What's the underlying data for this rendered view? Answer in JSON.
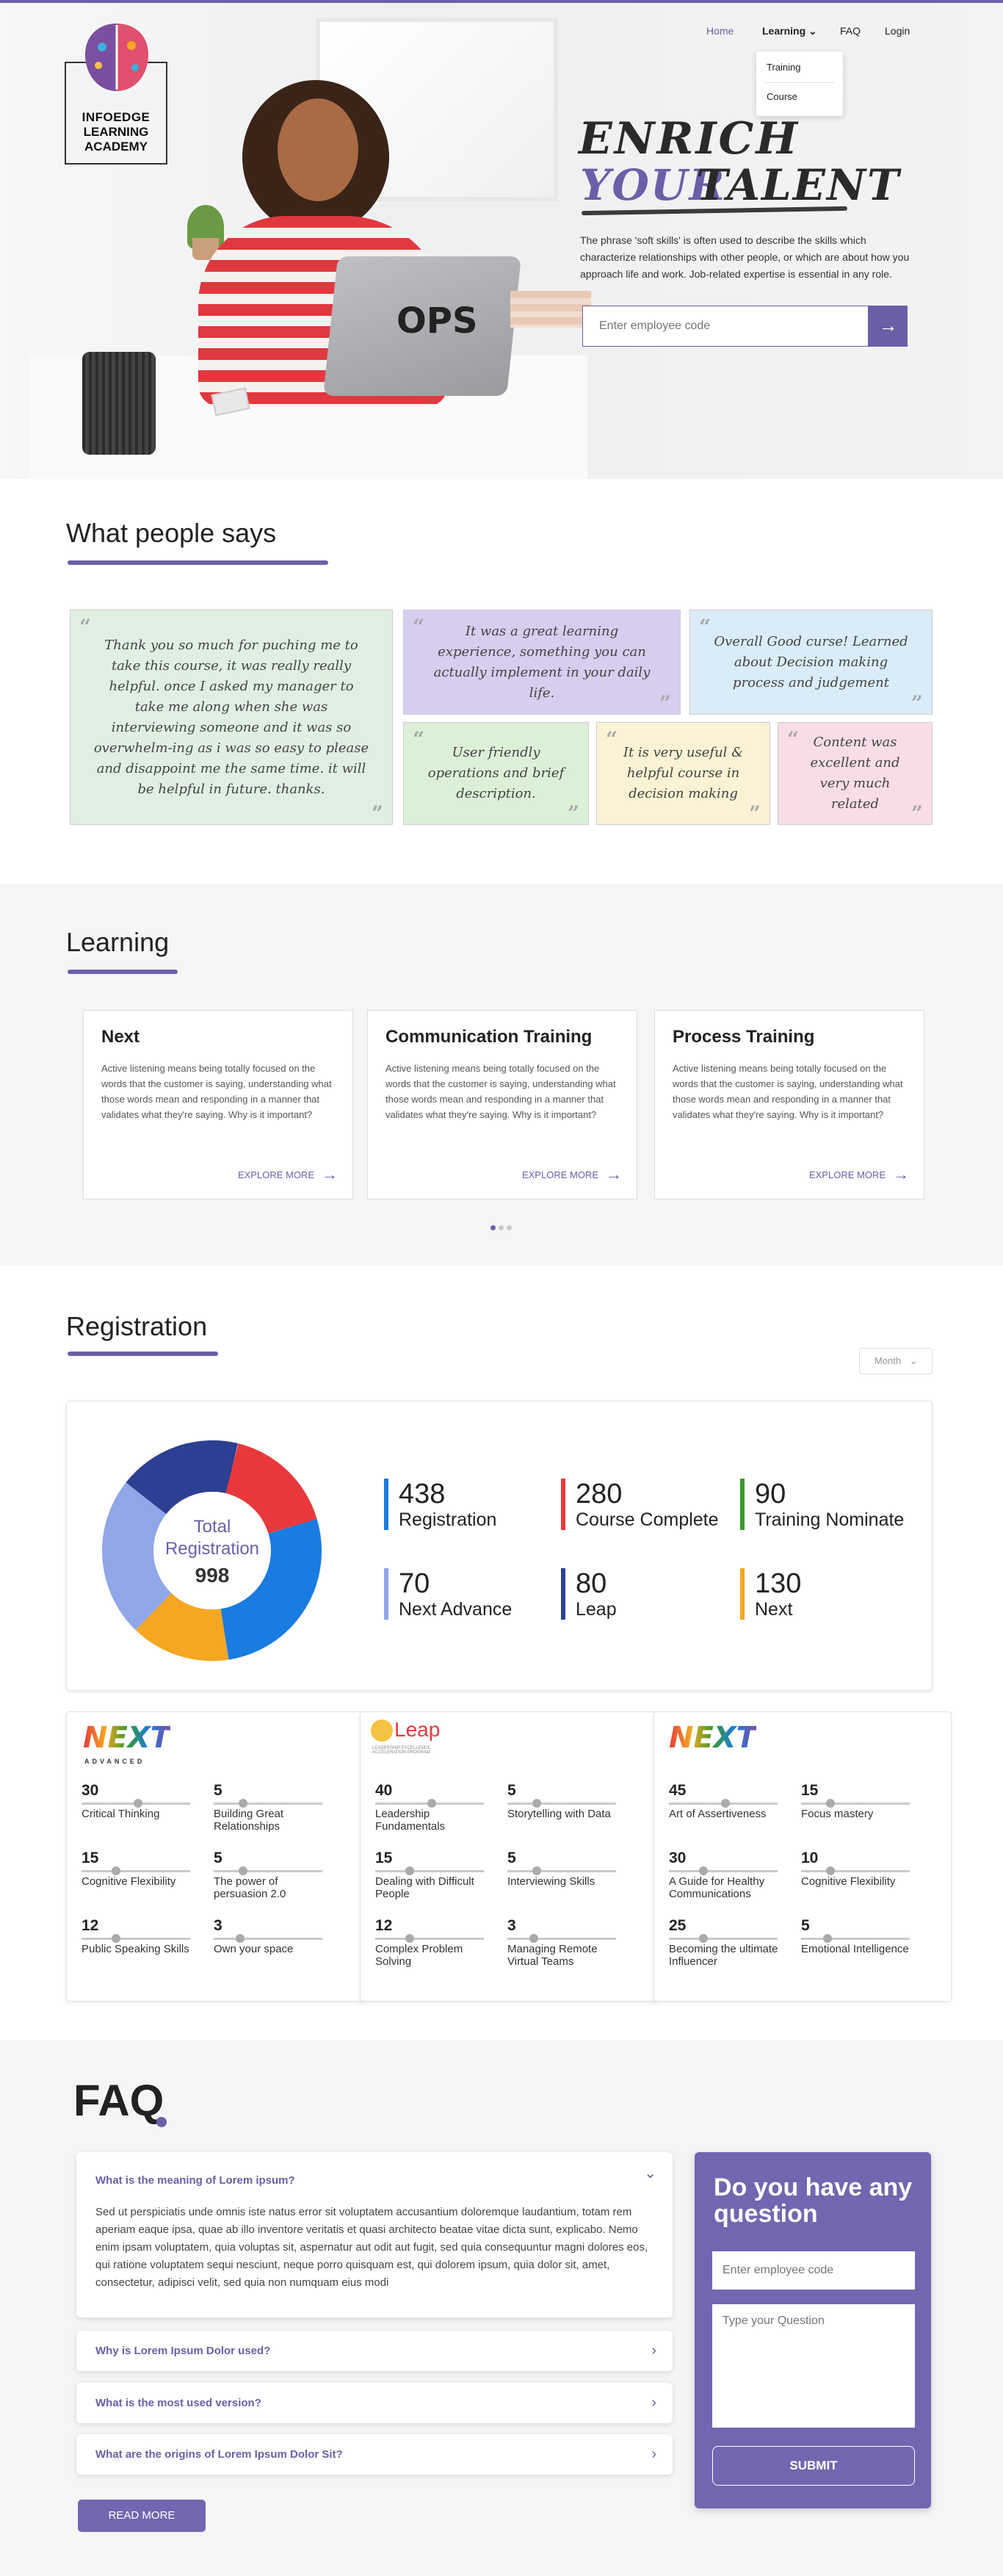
{
  "brand": {
    "line1": "INFOEDGE",
    "line2": "LEARNING",
    "line3": "ACADEMY",
    "laptop_logo": "OPS"
  },
  "nav": {
    "items": [
      {
        "label": "Home",
        "active": true
      },
      {
        "label": "Learning",
        "active": false,
        "has_dropdown": true
      },
      {
        "label": "FAQ",
        "active": false
      },
      {
        "label": "Login",
        "active": false
      }
    ],
    "dropdown": [
      "Training",
      "Course"
    ]
  },
  "hero": {
    "title_line1": "ENRICH",
    "title_line2a": "YOUR",
    "title_line2b": "TALENT",
    "description": "The phrase 'soft skills' is often used to describe the skills which characterize relationships with other people, or which are about how you approach life and work. Job-related expertise is essential in any role.",
    "input_placeholder": "Enter employee code",
    "submit_icon": "arrow-right-icon"
  },
  "testimonials": {
    "title": "What people says",
    "items": [
      "Thank you so much for puching me to take this course, it was really really helpful. once I asked my manager to take me along when she was interviewing someone and it was so overwhelm-ing as i was so easy to please and disappoint me the same time. it will be helpful in future. thanks.",
      "It was a great learning experience, something you can actually implement in your daily life.",
      "Overall Good curse! Learned about Decision making process and judgement",
      "User friendly operations and brief description.",
      "It is very useful & helpful course in decision making",
      "Content was excellent and very much related"
    ],
    "colors": [
      "#dff0e1",
      "#d7cdee",
      "#d9ecf7",
      "#dcefd7",
      "#fbf1d3",
      "#f8dde8"
    ]
  },
  "learning": {
    "title": "Learning",
    "cards": [
      {
        "title": "Next",
        "text": "Active listening means being totally focused on the words that the customer is saying, understanding what those words mean and responding in a manner that validates what they're saying. Why is it important?",
        "more": "EXPLORE MORE"
      },
      {
        "title": "Communication Training",
        "text": "Active listening means being totally focused on the words that the customer is saying, understanding what those words mean and responding in a manner that validates what they're saying. Why is it important?",
        "more": "EXPLORE MORE"
      },
      {
        "title": "Process Training",
        "text": "Active listening means being totally focused on the words that the customer is saying, understanding what those words mean and responding in a manner that validates what they're saying. Why is it important?",
        "more": "EXPLORE MORE"
      }
    ]
  },
  "registration": {
    "title": "Registration",
    "filter": "Month",
    "donut": {
      "label1": "Total",
      "label2": "Registration",
      "total": "998"
    },
    "stats": [
      {
        "value": "438",
        "label": "Registration",
        "color": "#1a7be0"
      },
      {
        "value": "280",
        "label": "Course Complete",
        "color": "#e8383b"
      },
      {
        "value": "90",
        "label": "Training Nominate",
        "color": "#3b9a2a"
      },
      {
        "value": "70",
        "label": "Next Advance",
        "color": "#8fa6e8"
      },
      {
        "value": "80",
        "label": "Leap",
        "color": "#2d3f91"
      },
      {
        "value": "130",
        "label": "Next",
        "color": "#f5a623"
      }
    ],
    "programs": [
      {
        "logo": "NEXT",
        "sub": "ADVANCED",
        "items": [
          {
            "value": "30",
            "label": "Critical Thinking",
            "level": 0.52
          },
          {
            "value": "5",
            "label": "Building Great Relationships",
            "level": 0.25
          },
          {
            "value": "15",
            "label": "Cognitive Flexibility",
            "level": 0.3
          },
          {
            "value": "5",
            "label": "The power of persuasion 2.0",
            "level": 0.25
          },
          {
            "value": "12",
            "label": "Public Speaking Skills",
            "level": 0.3
          },
          {
            "value": "3",
            "label": "Own your space",
            "level": 0.22
          }
        ]
      },
      {
        "logo": "Leap",
        "sub": "LEADERSHIP EXCELLENCE ACCELERATION PROGRAM",
        "items": [
          {
            "value": "40",
            "label": "Leadership Fundamentals",
            "level": 0.52
          },
          {
            "value": "5",
            "label": "Storytelling with Data",
            "level": 0.25
          },
          {
            "value": "15",
            "label": "Dealing with Difficult People",
            "level": 0.3
          },
          {
            "value": "5",
            "label": "Interviewing Skills",
            "level": 0.25
          },
          {
            "value": "12",
            "label": "Complex Problem Solving",
            "level": 0.3
          },
          {
            "value": "3",
            "label": "Managing Remote Virtual Teams",
            "level": 0.22
          }
        ]
      },
      {
        "logo": "NEXT",
        "sub": "",
        "items": [
          {
            "value": "45",
            "label": "Art of Assertiveness",
            "level": 0.52
          },
          {
            "value": "15",
            "label": "Focus mastery",
            "level": 0.25
          },
          {
            "value": "30",
            "label": "A Guide for Healthy Communications",
            "level": 0.3
          },
          {
            "value": "10",
            "label": "Cognitive Flexibility",
            "level": 0.25
          },
          {
            "value": "25",
            "label": "Becoming the ultimate Influencer",
            "level": 0.3
          },
          {
            "value": "5",
            "label": "Emotional Intelligence",
            "level": 0.22
          }
        ]
      }
    ]
  },
  "faq": {
    "title": "FAQ",
    "open_question": "What is the meaning of Lorem ipsum?",
    "open_answer": "Sed ut perspiciatis unde omnis iste natus error sit voluptatem accusantium doloremque laudantium, totam rem aperiam eaque ipsa, quae ab illo inventore veritatis et quasi architecto beatae vitae dicta sunt, explicabo. Nemo enim ipsam voluptatem, quia voluptas sit, aspernatur aut odit aut fugit, sed quia consequuntur magni dolores eos, qui ratione voluptatem sequi nesciunt, neque porro quisquam est, qui dolorem ipsum, quia dolor sit, amet, consectetur, adipisci velit, sed quia non numquam eius modi",
    "questions": [
      "Why is Lorem Ipsum Dolor used?",
      "What is the most used version?",
      "What are the origins of Lorem Ipsum Dolor Sit?"
    ],
    "read_more": "READ MORE",
    "ask": {
      "title": "Do you have any question",
      "input_placeholder": "Enter employee code",
      "textarea_placeholder": "Type your Question",
      "submit": "SUBMIT"
    }
  }
}
